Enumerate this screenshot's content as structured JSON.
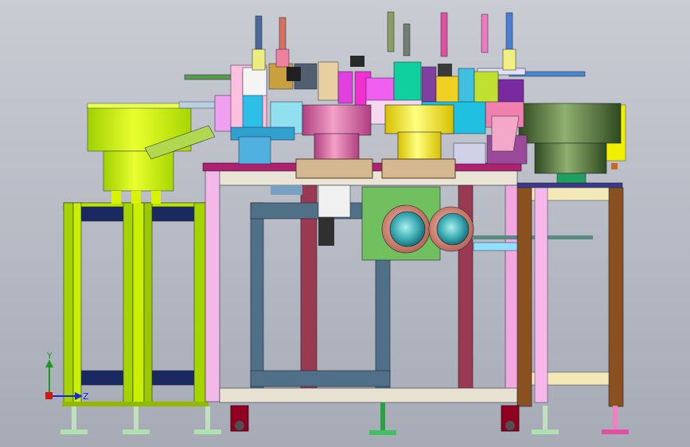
{
  "axis_triad": {
    "y_label": "Y",
    "z_label": "Z",
    "colors": {
      "x": "#d01818",
      "y": "#1a9a1a",
      "z": "#1a2ad0"
    }
  }
}
